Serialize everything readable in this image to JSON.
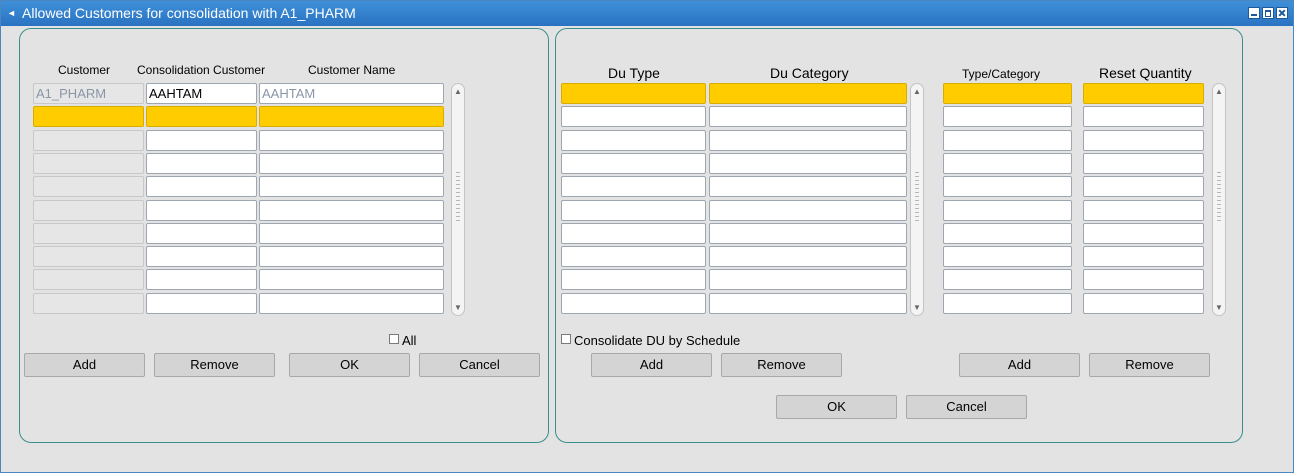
{
  "window": {
    "title": "Allowed Customers for consolidation with A1_PHARM"
  },
  "left_panel": {
    "headers": {
      "customer": "Customer",
      "consolidation_customer": "Consolidation Customer",
      "customer_name": "Customer Name"
    },
    "rows": [
      {
        "customer": "A1_PHARM",
        "consolidation_customer": "AAHTAM",
        "customer_name": "AAHTAM"
      },
      {
        "customer": "",
        "consolidation_customer": "",
        "customer_name": ""
      },
      {
        "customer": "",
        "consolidation_customer": "",
        "customer_name": ""
      },
      {
        "customer": "",
        "consolidation_customer": "",
        "customer_name": ""
      },
      {
        "customer": "",
        "consolidation_customer": "",
        "customer_name": ""
      },
      {
        "customer": "",
        "consolidation_customer": "",
        "customer_name": ""
      },
      {
        "customer": "",
        "consolidation_customer": "",
        "customer_name": ""
      },
      {
        "customer": "",
        "consolidation_customer": "",
        "customer_name": ""
      },
      {
        "customer": "",
        "consolidation_customer": "",
        "customer_name": ""
      },
      {
        "customer": "",
        "consolidation_customer": "",
        "customer_name": ""
      }
    ],
    "selected_row": 2,
    "all_checkbox_label": "All",
    "all_checked": false,
    "buttons": {
      "add": "Add",
      "remove": "Remove",
      "ok": "OK",
      "cancel": "Cancel"
    }
  },
  "right_panel": {
    "du_headers": {
      "du_type": "Du Type",
      "du_category": "Du Category"
    },
    "reset_headers": {
      "type_category": "Type/Category",
      "reset_quantity": "Reset Quantity"
    },
    "row_count": 10,
    "selected_row": 1,
    "consolidate_checkbox_label": "Consolidate DU by Schedule",
    "consolidate_checked": false,
    "du_buttons": {
      "add": "Add",
      "remove": "Remove"
    },
    "reset_buttons": {
      "add": "Add",
      "remove": "Remove"
    },
    "bottom_buttons": {
      "ok": "OK",
      "cancel": "Cancel"
    }
  },
  "colors": {
    "title_bar": "#2a73c2",
    "selected_row": "#ffcc00",
    "panel_border": "#3a8f8a"
  },
  "icons": [
    "app-icon",
    "minimize-icon",
    "maximize-icon",
    "close-icon",
    "scroll-up-icon",
    "scroll-down-icon"
  ]
}
